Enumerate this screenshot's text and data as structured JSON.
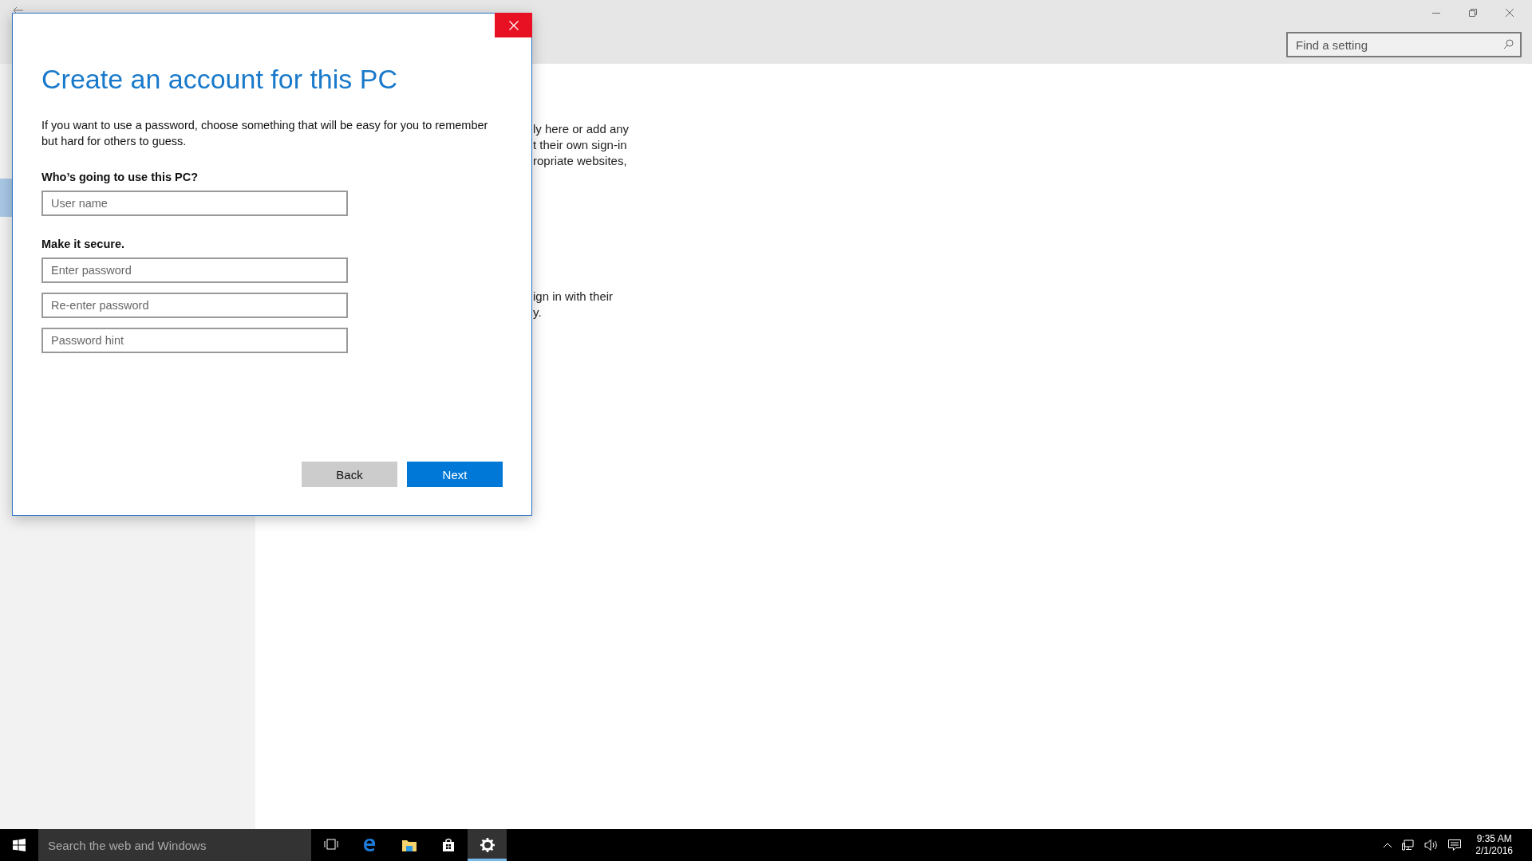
{
  "window": {
    "search": {
      "placeholder": "Find a setting"
    }
  },
  "sidebar": {
    "selection_highlight": true
  },
  "content": {
    "paragraphs": [
      [
        "ly here or add any",
        "t their own sign-in",
        "ropriate websites,"
      ],
      [
        "ign in with their",
        "y."
      ]
    ]
  },
  "dialog": {
    "title": "Create an account for this PC",
    "intro": "If you want to use a password, choose something that will be easy for you to remember but hard for others to guess.",
    "sections": [
      {
        "heading": "Who’s going to use this PC?",
        "fields": [
          {
            "placeholder": "User name"
          }
        ]
      },
      {
        "heading": "Make it secure.",
        "fields": [
          {
            "placeholder": "Enter password"
          },
          {
            "placeholder": "Re-enter password"
          },
          {
            "placeholder": "Password hint"
          }
        ]
      }
    ],
    "buttons": [
      {
        "label": "Back",
        "kind": "secondary"
      },
      {
        "label": "Next",
        "kind": "primary"
      }
    ]
  },
  "taskbar": {
    "search": {
      "placeholder": "Search the web and Windows"
    },
    "apps": [
      {
        "kind": "taskview",
        "active": false
      },
      {
        "kind": "browser",
        "active": false
      },
      {
        "kind": "folder",
        "active": false
      },
      {
        "kind": "store",
        "active": false
      },
      {
        "kind": "settings",
        "active": true
      }
    ],
    "time": "9:35 AM",
    "date": "2/1/2016"
  }
}
